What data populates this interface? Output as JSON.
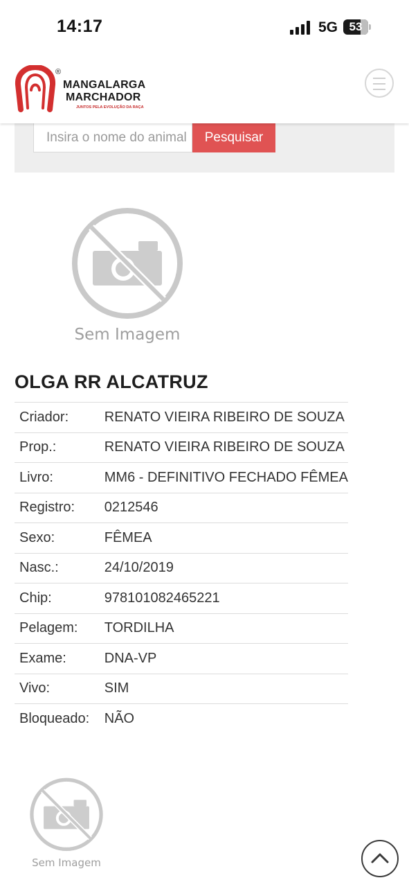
{
  "status_bar": {
    "time": "14:17",
    "network": "5G",
    "battery": "53"
  },
  "header": {
    "brand_line1": "MANGALARGA",
    "brand_line2": "MARCHADOR",
    "registered": "®",
    "tagline": "JUNTOS PELA EVOLUÇÃO DA RAÇA",
    "brand_color": "#d32f2f"
  },
  "search": {
    "placeholder": "Insira o nome do animal",
    "button": "Pesquisar",
    "button_color": "#e05353"
  },
  "placeholder_image": {
    "caption": "Sem Imagem"
  },
  "animal": {
    "name": "OLGA RR ALCATRUZ",
    "fields": [
      {
        "label": "Criador:",
        "value": "RENATO VIEIRA RIBEIRO DE SOUZA"
      },
      {
        "label": "Prop.:",
        "value": "RENATO VIEIRA RIBEIRO DE SOUZA"
      },
      {
        "label": "Livro:",
        "value": "MM6 - DEFINITIVO FECHADO FÊMEA"
      },
      {
        "label": "Registro:",
        "value": "0212546"
      },
      {
        "label": "Sexo:",
        "value": "FÊMEA"
      },
      {
        "label": "Nasc.:",
        "value": "24/10/2019"
      },
      {
        "label": "Chip:",
        "value": "978101082465221"
      },
      {
        "label": "Pelagem:",
        "value": "TORDILHA"
      },
      {
        "label": "Exame:",
        "value": "DNA-VP"
      },
      {
        "label": "Vivo:",
        "value": "SIM"
      },
      {
        "label": "Bloqueado:",
        "value": "NÃO"
      }
    ]
  },
  "icons": {
    "menu": "hamburger-icon",
    "scroll_top": "chevron-up-icon",
    "no_image": "camera-off-icon"
  }
}
